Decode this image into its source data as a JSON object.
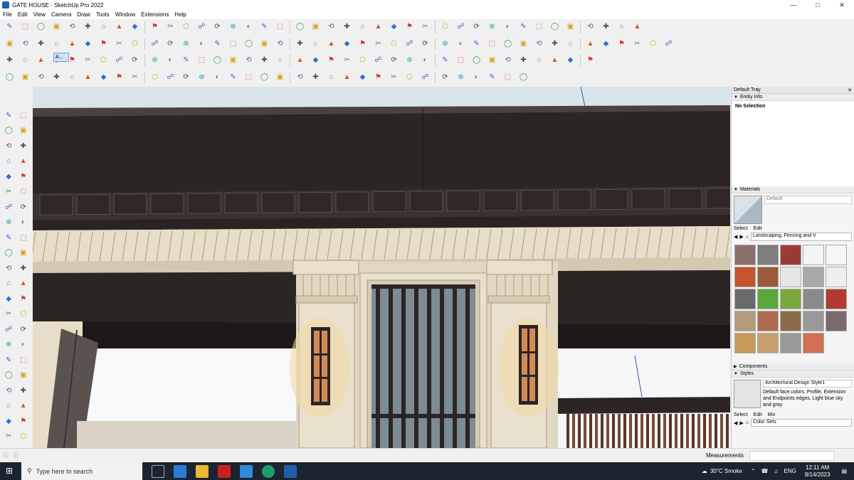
{
  "window": {
    "title": "GATE HOUSE - SketchUp Pro 2022",
    "min_icon": "minimize-icon",
    "max_icon": "maximize-icon",
    "close_icon": "close-icon"
  },
  "menu": [
    "File",
    "Edit",
    "View",
    "Camera",
    "Draw",
    "Tools",
    "Window",
    "Extensions",
    "Help"
  ],
  "layers_tag_label": "A...",
  "default_tray": {
    "title": "Default Tray",
    "entity_info": {
      "label": "Entity Info",
      "status": "No Selection"
    },
    "materials": {
      "label": "Materials",
      "default_name": "Default",
      "tab_select": "Select",
      "tab_edit": "Edit",
      "collection": "Landscaping, Fencing and V"
    },
    "components": {
      "label": "Components"
    },
    "styles": {
      "label": "Styles",
      "style_name": "Architectural Design Style1",
      "description": "Default face colors. Profile, Extension and Endpoints edges. Light blue sky and gray",
      "tab_select": "Select",
      "tab_edit": "Edit",
      "tab_mix": "Mix",
      "collection": "Color Sets"
    }
  },
  "status": {
    "measurements": "Measurements"
  },
  "taskbar": {
    "search_placeholder": "Type here to search",
    "weather": "30°C  Smoke",
    "lang": "ENG",
    "time": "12:11 AM",
    "date": "8/14/2023"
  },
  "colors": {
    "accent": "#1f5fa8",
    "taskbar": "#1c2430",
    "sky": "#c6d6de",
    "stone": "#e7ddc8",
    "dark": "#2b2524"
  }
}
